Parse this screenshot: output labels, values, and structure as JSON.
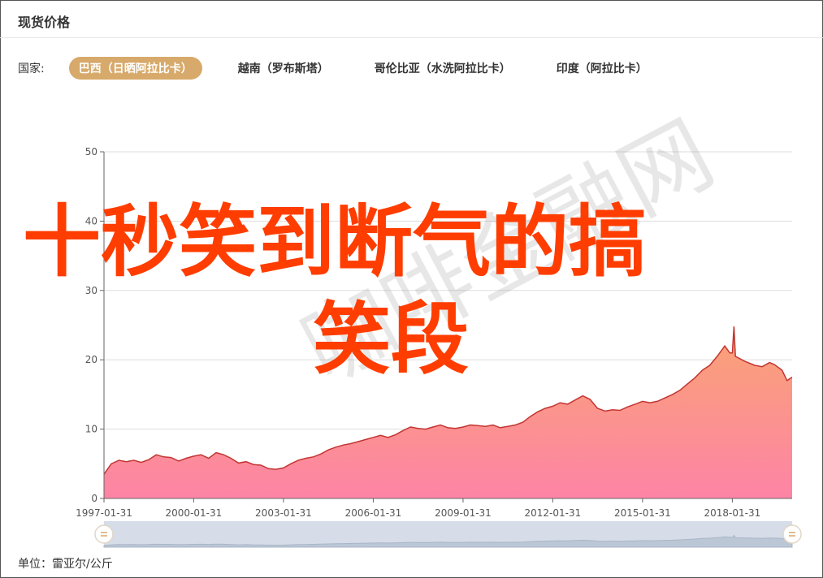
{
  "header": {
    "title": "现货价格"
  },
  "filter": {
    "label": "国家:",
    "options": [
      {
        "label": "巴西（日晒阿拉比卡）",
        "active": true
      },
      {
        "label": "越南（罗布斯塔）",
        "active": false
      },
      {
        "label": "哥伦比亚（水洗阿拉比卡）",
        "active": false
      },
      {
        "label": "印度（阿拉比卡）",
        "active": false
      }
    ]
  },
  "overlay": {
    "line1": "十秒笑到断气的搞",
    "line2": "笑段"
  },
  "watermark": "咖啡金融网",
  "footer": {
    "unit": "单位：雷亚尔/公斤"
  },
  "colors": {
    "accent": "#d7a96a",
    "overlay": "#ff3d00",
    "line": "#c23531",
    "area_top": "#f9a374",
    "area_bottom": "#fd84a6"
  },
  "chart_data": {
    "type": "area",
    "title": "",
    "xlabel": "",
    "ylabel": "",
    "ylim": [
      0,
      50
    ],
    "yticks": [
      0,
      10,
      20,
      30,
      40,
      50
    ],
    "x_ticks": [
      "1997-01-31",
      "2000-01-31",
      "2003-01-31",
      "2006-01-31",
      "2009-01-31",
      "2012-01-31",
      "2015-01-31",
      "2018-01-31"
    ],
    "grid": true,
    "series": [
      {
        "points": [
          [
            "1997-01-31",
            3.5
          ],
          [
            "1997-04-30",
            5.0
          ],
          [
            "1997-07-31",
            5.5
          ],
          [
            "1997-10-31",
            5.3
          ],
          [
            "1998-01-31",
            5.5
          ],
          [
            "1998-04-30",
            5.2
          ],
          [
            "1998-07-31",
            5.6
          ],
          [
            "1998-10-31",
            6.3
          ],
          [
            "1999-01-31",
            6.0
          ],
          [
            "1999-04-30",
            5.9
          ],
          [
            "1999-07-31",
            5.4
          ],
          [
            "1999-10-31",
            5.8
          ],
          [
            "2000-01-31",
            6.1
          ],
          [
            "2000-04-30",
            6.3
          ],
          [
            "2000-07-31",
            5.8
          ],
          [
            "2000-10-31",
            6.6
          ],
          [
            "2001-01-31",
            6.3
          ],
          [
            "2001-04-30",
            5.8
          ],
          [
            "2001-07-31",
            5.1
          ],
          [
            "2001-10-31",
            5.3
          ],
          [
            "2002-01-31",
            4.9
          ],
          [
            "2002-04-30",
            4.8
          ],
          [
            "2002-07-31",
            4.3
          ],
          [
            "2002-10-31",
            4.2
          ],
          [
            "2003-01-31",
            4.4
          ],
          [
            "2003-04-30",
            5.0
          ],
          [
            "2003-07-31",
            5.5
          ],
          [
            "2003-10-31",
            5.8
          ],
          [
            "2004-01-31",
            6.0
          ],
          [
            "2004-04-30",
            6.4
          ],
          [
            "2004-07-31",
            7.0
          ],
          [
            "2004-10-31",
            7.4
          ],
          [
            "2005-01-31",
            7.7
          ],
          [
            "2005-04-30",
            7.9
          ],
          [
            "2005-07-31",
            8.2
          ],
          [
            "2005-10-31",
            8.5
          ],
          [
            "2006-01-31",
            8.8
          ],
          [
            "2006-04-30",
            9.1
          ],
          [
            "2006-07-31",
            8.8
          ],
          [
            "2006-10-31",
            9.2
          ],
          [
            "2007-01-31",
            9.8
          ],
          [
            "2007-04-30",
            10.3
          ],
          [
            "2007-07-31",
            10.1
          ],
          [
            "2007-10-31",
            10.0
          ],
          [
            "2008-01-31",
            10.3
          ],
          [
            "2008-04-30",
            10.6
          ],
          [
            "2008-07-31",
            10.2
          ],
          [
            "2008-10-31",
            10.1
          ],
          [
            "2009-01-31",
            10.3
          ],
          [
            "2009-04-30",
            10.6
          ],
          [
            "2009-07-31",
            10.5
          ],
          [
            "2009-10-31",
            10.4
          ],
          [
            "2010-01-31",
            10.6
          ],
          [
            "2010-04-30",
            10.2
          ],
          [
            "2010-07-31",
            10.4
          ],
          [
            "2010-10-31",
            10.6
          ],
          [
            "2011-01-31",
            11.0
          ],
          [
            "2011-04-30",
            11.8
          ],
          [
            "2011-07-31",
            12.5
          ],
          [
            "2011-10-31",
            13.0
          ],
          [
            "2012-01-31",
            13.3
          ],
          [
            "2012-04-30",
            13.8
          ],
          [
            "2012-07-31",
            13.6
          ],
          [
            "2012-10-31",
            14.2
          ],
          [
            "2013-01-31",
            14.8
          ],
          [
            "2013-04-30",
            14.3
          ],
          [
            "2013-07-31",
            13.0
          ],
          [
            "2013-10-31",
            12.6
          ],
          [
            "2014-01-31",
            12.8
          ],
          [
            "2014-04-30",
            12.7
          ],
          [
            "2014-07-31",
            13.2
          ],
          [
            "2014-10-31",
            13.6
          ],
          [
            "2015-01-31",
            14.0
          ],
          [
            "2015-04-30",
            13.8
          ],
          [
            "2015-07-31",
            14.0
          ],
          [
            "2015-10-31",
            14.5
          ],
          [
            "2016-01-31",
            15.0
          ],
          [
            "2016-04-30",
            15.6
          ],
          [
            "2016-07-31",
            16.5
          ],
          [
            "2016-10-31",
            17.4
          ],
          [
            "2017-01-31",
            18.5
          ],
          [
            "2017-04-30",
            19.2
          ],
          [
            "2017-07-31",
            20.5
          ],
          [
            "2017-10-31",
            22.0
          ],
          [
            "2017-12-31",
            21.0
          ],
          [
            "2018-01-31",
            21.0
          ],
          [
            "2018-02-20",
            24.8
          ],
          [
            "2018-03-10",
            20.5
          ],
          [
            "2018-06-30",
            19.8
          ],
          [
            "2018-10-31",
            19.2
          ],
          [
            "2019-01-31",
            19.0
          ],
          [
            "2019-04-30",
            19.6
          ],
          [
            "2019-06-30",
            19.3
          ],
          [
            "2019-09-30",
            18.5
          ],
          [
            "2019-11-30",
            17.0
          ],
          [
            "2020-01-31",
            17.5
          ]
        ]
      }
    ]
  }
}
